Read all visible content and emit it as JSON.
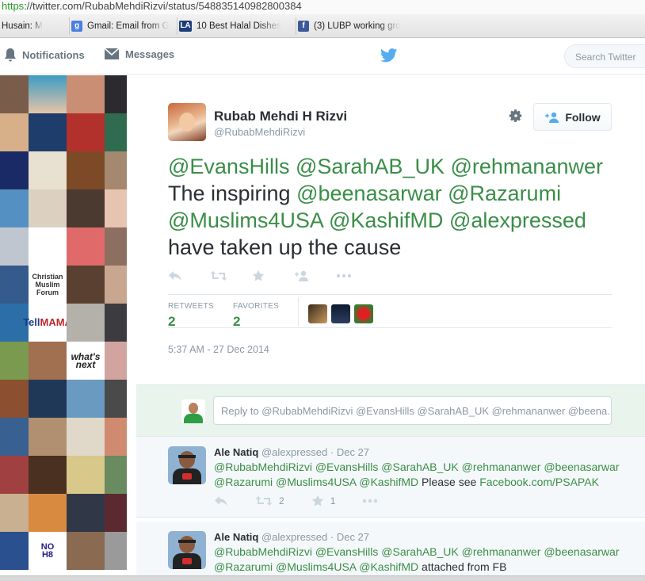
{
  "browser": {
    "url_protocol": "https",
    "url_rest": "://twitter.com/RubabMehdiRizvi/status/548835140982800384",
    "bookmarks": [
      {
        "label": "Husain: M",
        "icon": "none"
      },
      {
        "label": "Gmail: Email from G",
        "icon": "google-icon"
      },
      {
        "label": "10 Best Halal Dishes",
        "icon": "la-icon"
      },
      {
        "label": "(3) LUBP working gro",
        "icon": "facebook-icon"
      }
    ]
  },
  "nav": {
    "notifications": "Notifications",
    "messages": "Messages",
    "search_placeholder": "Search Twitter"
  },
  "tweet": {
    "fullname": "Rubab Mehdi H Rizvi",
    "screenname": "@RubabMehdiRizvi",
    "follow_label": "Follow",
    "line1": [
      "@EvansHills",
      "@SarahAB_UK",
      "@rehmananwer"
    ],
    "line2_prefix": "The inspiring",
    "line2": [
      "@beenasarwar",
      "@Razarumi"
    ],
    "line3": [
      "@Muslims4USA",
      "@KashifMD",
      "@alexpressed"
    ],
    "line4": "have taken up the cause",
    "retweets_label": "RETWEETS",
    "retweets": "2",
    "favorites_label": "FAVORITES",
    "favorites": "2",
    "timestamp": "5:37 AM - 27 Dec 2014"
  },
  "reply_box": {
    "placeholder": "Reply to @RubabMehdiRizvi @EvansHills @SarahAB_UK @rehmananwer @beena..."
  },
  "replies": [
    {
      "name": "Ale Natiq",
      "handle": "@alexpressed",
      "date": "· Dec 27",
      "mentions1": "@RubabMehdiRizvi @EvansHills @SarahAB_UK @rehmananwer @beenasarwar",
      "mentions2": "@Razarumi @Muslims4USA @KashifMD",
      "text": "Please see",
      "link": "Facebook.com/PSAPAK",
      "retweet_count": "2",
      "fav_count": "1"
    },
    {
      "name": "Ale Natiq",
      "handle": "@alexpressed",
      "date": "· Dec 27",
      "mentions1": "@RubabMehdiRizvi @EvansHills @SarahAB_UK @rehmananwer @beenasarwar",
      "mentions2": "@Razarumi @Muslims4USA @KashifMD",
      "text": "attached from FB"
    }
  ],
  "colors": {
    "link_green": "#3a8e48",
    "twitter_blue": "#55acee",
    "muted": "#8899a6"
  }
}
